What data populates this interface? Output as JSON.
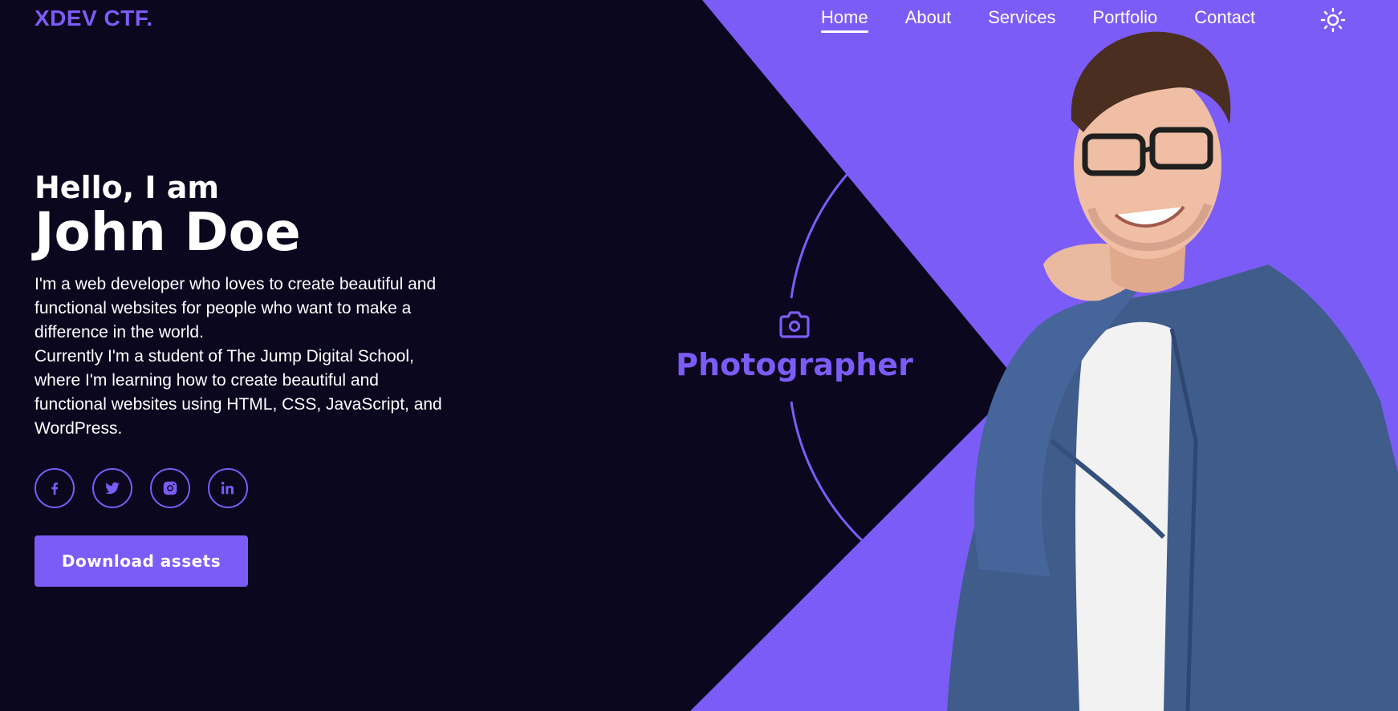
{
  "header": {
    "logo": "XDEV CTF.",
    "nav": [
      {
        "label": "Home",
        "active": true
      },
      {
        "label": "About",
        "active": false
      },
      {
        "label": "Services",
        "active": false
      },
      {
        "label": "Portfolio",
        "active": false
      },
      {
        "label": "Contact",
        "active": false
      }
    ],
    "theme_icon": "sun-icon"
  },
  "hero": {
    "greeting": "Hello, I am",
    "name": "John Doe",
    "bio_lines": [
      "I'm a web developer who loves to create beautiful and",
      "functional websites for people who want to make a",
      "difference in the world.",
      "Currently I'm a student of The Jump Digital School,",
      "where I'm learning how to create beautiful and",
      "functional websites using HTML, CSS, JavaScript, and",
      "WordPress."
    ],
    "socials": [
      {
        "icon": "facebook-icon"
      },
      {
        "icon": "twitter-icon"
      },
      {
        "icon": "instagram-icon"
      },
      {
        "icon": "linkedin-icon"
      }
    ],
    "button_label": "Download assets"
  },
  "role": {
    "icon": "camera-icon",
    "label": "Photographer"
  },
  "colors": {
    "background": "#0b071f",
    "accent": "#7c5cf7",
    "text": "#ffffff"
  }
}
